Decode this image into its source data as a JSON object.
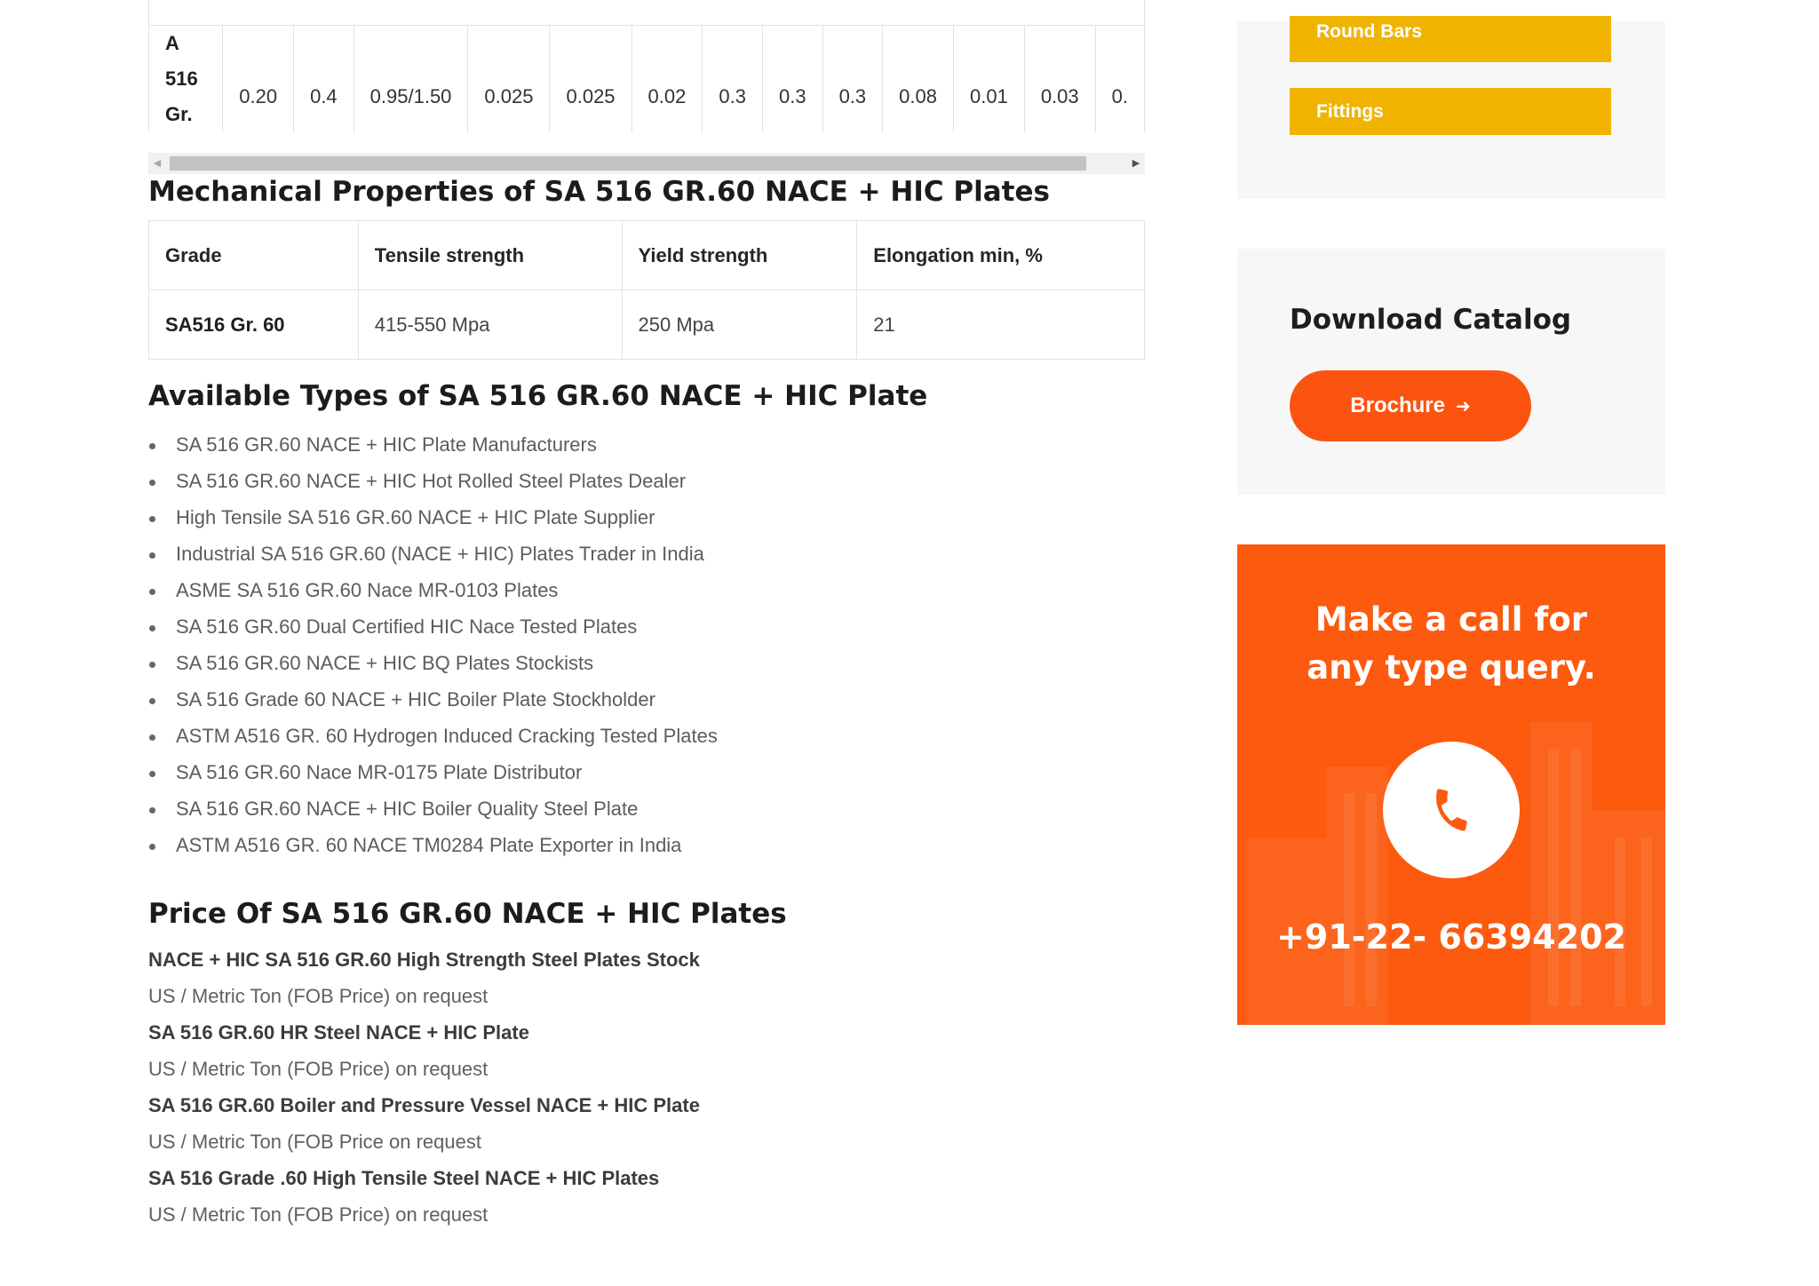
{
  "composition_row": {
    "grade": "A 516 Gr. 60",
    "values": [
      "0.20",
      "0.4",
      "0.95/1.50",
      "0.025",
      "0.025",
      "0.02",
      "0.3",
      "0.3",
      "0.3",
      "0.08",
      "0.01",
      "0.03",
      "0."
    ]
  },
  "mechanical": {
    "title": "Mechanical Properties of SA 516 GR.60 NACE + HIC Plates",
    "headers": [
      "Grade",
      "Tensile strength",
      "Yield strength",
      "Elongation min, %"
    ],
    "row": [
      "SA516 Gr. 60",
      "415-550 Mpa",
      "250 Mpa",
      "21"
    ]
  },
  "types": {
    "title": "Available Types of SA 516 GR.60 NACE + HIC Plate",
    "items": [
      "SA 516 GR.60 NACE + HIC Plate Manufacturers",
      "SA 516 GR.60 NACE + HIC Hot Rolled Steel Plates Dealer",
      "High Tensile SA 516 GR.60 NACE + HIC Plate Supplier",
      "Industrial SA 516 GR.60 (NACE + HIC) Plates Trader in India",
      "ASME SA 516 GR.60 Nace MR-0103 Plates",
      "SA 516 GR.60 Dual Certified HIC Nace Tested Plates",
      "SA 516 GR.60 NACE + HIC BQ Plates Stockists",
      "SA 516 Grade 60 NACE + HIC Boiler Plate Stockholder",
      "ASTM A516 GR. 60 Hydrogen Induced Cracking Tested Plates",
      "SA 516 GR.60 Nace MR-0175 Plate Distributor",
      "SA 516 GR.60 NACE + HIC Boiler Quality Steel Plate",
      "ASTM A516 GR. 60 NACE TM0284 Plate Exporter in India"
    ]
  },
  "price": {
    "title": "Price Of SA 516 GR.60 NACE + HIC Plates",
    "entries": [
      {
        "name": "NACE + HIC SA 516 GR.60 High Strength Steel Plates Stock",
        "note": "US / Metric Ton (FOB Price) on request"
      },
      {
        "name": "SA 516 GR.60 HR Steel NACE + HIC Plate",
        "note": "US / Metric Ton (FOB Price) on request"
      },
      {
        "name": "SA 516 GR.60 Boiler and Pressure Vessel NACE + HIC Plate",
        "note": "US / Metric Ton (FOB Price on request"
      },
      {
        "name": "SA 516 Grade .60 High Tensile Steel NACE + HIC Plates",
        "note": "US / Metric Ton (FOB Price) on request"
      }
    ]
  },
  "sidebar": {
    "product_links": [
      "Round Bars",
      "Fittings"
    ],
    "download": {
      "title": "Download Catalog",
      "button": "Brochure"
    },
    "call": {
      "line1": "Make a call for",
      "line2": "any type query.",
      "phone": "+91-22- 66394202"
    }
  },
  "colors": {
    "accent_orange": "#fc5a0f",
    "button_yellow": "#f0b400"
  }
}
